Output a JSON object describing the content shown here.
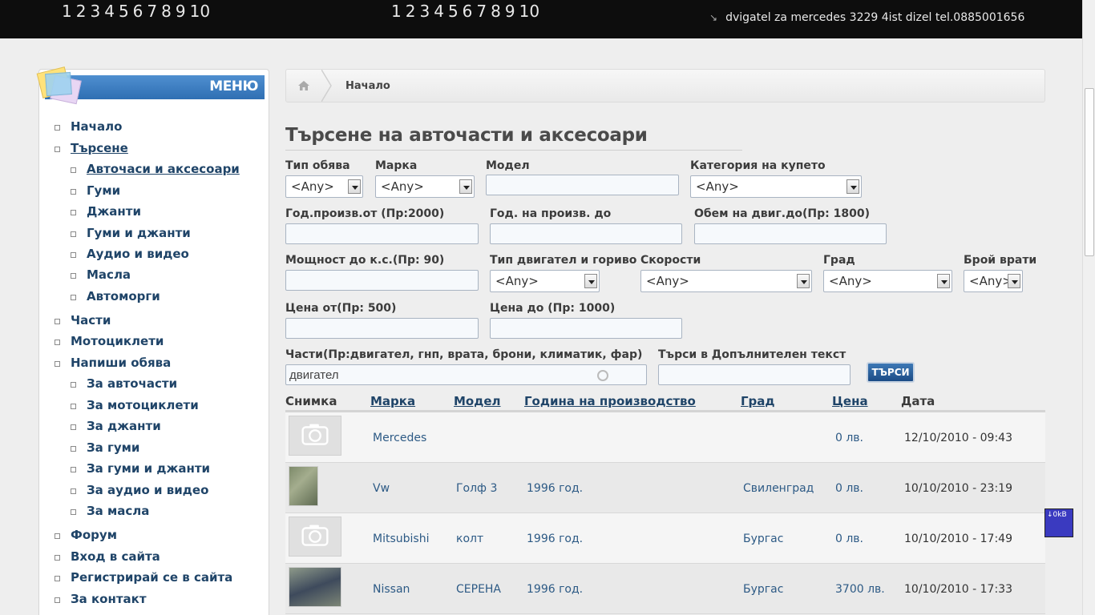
{
  "top": {
    "pager1": [
      "1",
      "2",
      "3",
      "4",
      "5",
      "6",
      "7",
      "8",
      "9",
      "10"
    ],
    "pager2": [
      "1",
      "2",
      "3",
      "4",
      "5",
      "6",
      "7",
      "8",
      "9",
      "10"
    ],
    "ticker": "dvigatel za mercedes 3229 4ist dizel tel.0885001656"
  },
  "sidebar": {
    "header": "МЕНЮ",
    "items": [
      {
        "label": "Начало",
        "level": 1
      },
      {
        "label": "Търсене",
        "level": 1,
        "active": true
      },
      {
        "label": "Авточаси и аксесоари",
        "level": 2,
        "active": true
      },
      {
        "label": "Гуми",
        "level": 2
      },
      {
        "label": "Джанти",
        "level": 2
      },
      {
        "label": "Гуми и джанти",
        "level": 2
      },
      {
        "label": "Аудио и видео",
        "level": 2
      },
      {
        "label": "Масла",
        "level": 2
      },
      {
        "label": "Автоморги",
        "level": 2
      },
      {
        "label": "Части",
        "level": 1
      },
      {
        "label": "Мотоциклети",
        "level": 1
      },
      {
        "label": "Напиши обява",
        "level": 1
      },
      {
        "label": "За авточасти",
        "level": 2
      },
      {
        "label": "За мотоциклети",
        "level": 2
      },
      {
        "label": "За джанти",
        "level": 2
      },
      {
        "label": "За гуми",
        "level": 2
      },
      {
        "label": "За гуми и джанти",
        "level": 2
      },
      {
        "label": "За аудио и видео",
        "level": 2
      },
      {
        "label": "За масла",
        "level": 2
      },
      {
        "label": "Форум",
        "level": 1
      },
      {
        "label": "Вход в сайта",
        "level": 1
      },
      {
        "label": "Регистрирай се в сайта",
        "level": 1
      },
      {
        "label": "За контакт",
        "level": 1
      }
    ]
  },
  "breadcrumb": {
    "home": "Начало"
  },
  "title": "Търсене на авточасти и аксесоари",
  "form": {
    "ad_type": {
      "label": "Тип обява",
      "value": "<Any>"
    },
    "make": {
      "label": "Марка",
      "value": "<Any>"
    },
    "model": {
      "label": "Модел",
      "value": ""
    },
    "body_category": {
      "label": "Категория на купето",
      "value": "<Any>"
    },
    "year_from": {
      "label": "Год.произв.от (Пр:2000)",
      "value": ""
    },
    "year_to": {
      "label": "Год. на произв. до",
      "value": ""
    },
    "engine_volume": {
      "label": "Обем на двиг.до(Пр: 1800)",
      "value": ""
    },
    "power": {
      "label": "Мощност до к.с.(Пр: 90)",
      "value": ""
    },
    "engine_fuel": {
      "label": "Тип двигател и гориво",
      "value": "<Any>"
    },
    "gears": {
      "label": "Скорости",
      "value": "<Any>"
    },
    "city": {
      "label": "Град",
      "value": "<Any>"
    },
    "doors": {
      "label": "Брой врати",
      "value": "<Any>"
    },
    "price_from": {
      "label": "Цена от(Пр: 500)",
      "value": ""
    },
    "price_to": {
      "label": "Цена до (Пр: 1000)",
      "value": ""
    },
    "parts": {
      "label": "Части(Пр:двигател, гнп, врата, брони, климатик, фар)",
      "value": "двигател"
    },
    "extra_text": {
      "label": "Търси в Допълнителен текст",
      "value": ""
    },
    "search_button": "ТЪРСИ"
  },
  "table": {
    "headers": {
      "photo": "Снимка",
      "make": "Марка",
      "model": "Модел",
      "year": "Година на производство",
      "city": "Град",
      "price": "Цена",
      "date": "Дата"
    },
    "rows": [
      {
        "make": "Mercedes",
        "model": "",
        "year": "",
        "city": "",
        "price": "0 лв.",
        "date": "12/10/2010 - 09:43",
        "photo": "placeholder"
      },
      {
        "make": "Vw",
        "model": "Голф 3",
        "year": "1996 год.",
        "city": "Свиленград",
        "price": "0 лв.",
        "date": "10/10/2010 - 23:19",
        "photo": "image"
      },
      {
        "make": "Mitsubishi",
        "model": "колт",
        "year": "1996 год.",
        "city": "Бургас",
        "price": "0 лв.",
        "date": "10/10/2010 - 17:49",
        "photo": "placeholder"
      },
      {
        "make": "Nissan",
        "model": "СЕРЕНА",
        "year": "1996 год.",
        "city": "Бургас",
        "price": "3700 лв.",
        "date": "10/10/2010 - 17:33",
        "photo": "image"
      }
    ]
  },
  "widget": {
    "kb": "↓0kB"
  },
  "colors": {
    "accent": "#2f6fb3",
    "link": "#1f4468",
    "button": "#1c4c86"
  },
  "icons": {
    "home": "home-icon",
    "camera": "camera-placeholder-icon",
    "arrow": "arrow-down-right-icon"
  }
}
